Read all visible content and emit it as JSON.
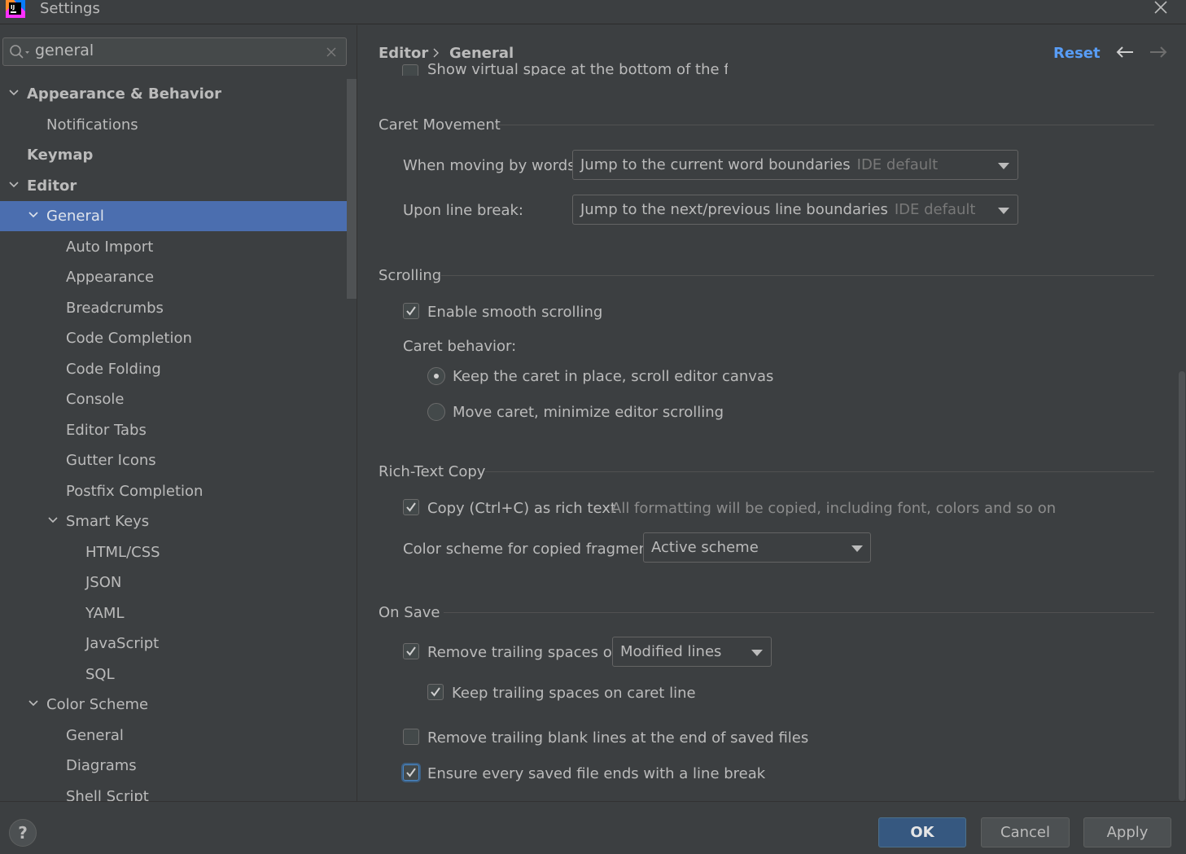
{
  "window": {
    "title": "Settings"
  },
  "search": {
    "value": "general"
  },
  "tree": [
    {
      "label": "Appearance & Behavior",
      "bold": true,
      "expanded": true,
      "level": 0
    },
    {
      "label": "Notifications",
      "level": 1
    },
    {
      "label": "Keymap",
      "bold": true,
      "level": 0
    },
    {
      "label": "Editor",
      "bold": true,
      "expanded": true,
      "level": 0
    },
    {
      "label": "General",
      "expanded": true,
      "selected": true,
      "level": 1
    },
    {
      "label": "Auto Import",
      "level": 2
    },
    {
      "label": "Appearance",
      "level": 2
    },
    {
      "label": "Breadcrumbs",
      "level": 2
    },
    {
      "label": "Code Completion",
      "level": 2
    },
    {
      "label": "Code Folding",
      "level": 2
    },
    {
      "label": "Console",
      "level": 2
    },
    {
      "label": "Editor Tabs",
      "level": 2
    },
    {
      "label": "Gutter Icons",
      "level": 2
    },
    {
      "label": "Postfix Completion",
      "level": 2
    },
    {
      "label": "Smart Keys",
      "expanded": true,
      "level": 2
    },
    {
      "label": "HTML/CSS",
      "level": 3
    },
    {
      "label": "JSON",
      "level": 3
    },
    {
      "label": "YAML",
      "level": 3
    },
    {
      "label": "JavaScript",
      "level": 3
    },
    {
      "label": "SQL",
      "level": 3
    },
    {
      "label": "Color Scheme",
      "expanded": true,
      "level": 1
    },
    {
      "label": "General",
      "level": 2
    },
    {
      "label": "Diagrams",
      "level": 2
    },
    {
      "label": "Shell Script",
      "level": 2
    }
  ],
  "header": {
    "breadcrumb_parent": "Editor",
    "breadcrumb_current": "General",
    "reset_label": "Reset"
  },
  "partial_line": "Show virtual space at the bottom of the file",
  "caret_movement": {
    "title": "Caret Movement",
    "words_label": "When moving by words:",
    "words_value": "Jump to the current word boundaries",
    "words_default": "IDE default",
    "linebreak_label": "Upon line break:",
    "linebreak_value": "Jump to the next/previous line boundaries",
    "linebreak_default": "IDE default"
  },
  "scrolling": {
    "title": "Scrolling",
    "smooth_label": "Enable smooth scrolling",
    "smooth_checked": true,
    "caret_behavior_label": "Caret behavior:",
    "radio_keep": "Keep the caret in place, scroll editor canvas",
    "radio_move": "Move caret, minimize editor scrolling",
    "selected_radio": "keep"
  },
  "rich_text": {
    "title": "Rich-Text Copy",
    "copy_label": "Copy (Ctrl+C) as rich text",
    "copy_checked": true,
    "copy_hint": "All formatting will be copied, including font, colors and so on",
    "scheme_label": "Color scheme for copied fragment:",
    "scheme_value": "Active scheme"
  },
  "on_save": {
    "title": "On Save",
    "trailing_label": "Remove trailing spaces on:",
    "trailing_checked": true,
    "trailing_value": "Modified lines",
    "keep_caret_label": "Keep trailing spaces on caret line",
    "keep_caret_checked": true,
    "blank_lines_label": "Remove trailing blank lines at the end of saved files",
    "blank_lines_checked": false,
    "line_break_label": "Ensure every saved file ends with a line break",
    "line_break_checked": true
  },
  "footer": {
    "help": "?",
    "ok": "OK",
    "cancel": "Cancel",
    "apply": "Apply"
  },
  "colors": {
    "background": "#3c3f41",
    "selection": "#4b6eaf",
    "link": "#589df6",
    "primary_button": "#365880"
  }
}
